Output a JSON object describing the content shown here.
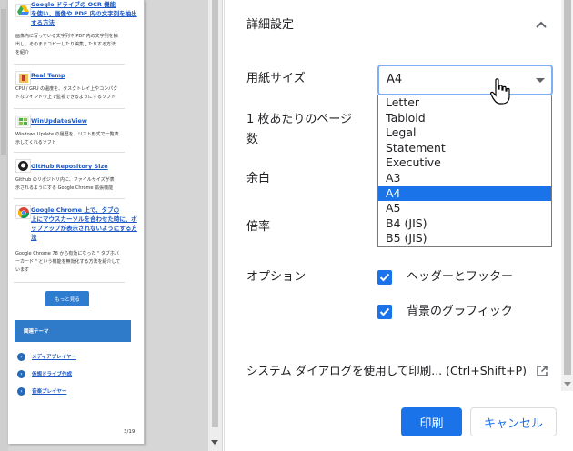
{
  "preview": {
    "items": [
      {
        "link": "Google ドライブの OCR 機能\nを使い、画像や PDF 内の文字列を抽出\nする方法",
        "desc": "画像内に写っている文字列や PDF 内の文字列を抽\n出し、そのままコピーしたり編集したりする方法\nを紹介",
        "icon": "google-drive-icon"
      },
      {
        "link": "Real Temp",
        "desc": "CPU / GPU の温度を、タスクトレイ上やコンパク\nトなウインドウ上で監視できるようにするソフト",
        "icon": "thermometer-icon"
      },
      {
        "link": "WinUpdatesView",
        "desc": "Windows Update の履歴を、リスト形式で一覧表\n示してくれるソフト",
        "icon": "windows-icon"
      },
      {
        "link": "GitHub Repository Size",
        "desc": "GitHub のリポジトリ内に、ファイルサイズが表\n示されるようにする Google Chrome 拡張機能",
        "icon": "github-icon"
      },
      {
        "link": "Google Chrome 上で、タブの\n上にマウスカーソルを合わせた時に、ポ\nップアップが表示されないようにする方\n法",
        "desc": "Google Chrome 78 から有効になった \" タブホバ\nーカード \" という機能を無効化する方法を紹介して\nいます",
        "icon": "chrome-icon"
      }
    ],
    "more_button": "もっと見る",
    "theme_header": "関連テーマ",
    "theme_links": [
      "メディアプレイヤー",
      "仮想ドライブ作成",
      "音楽プレイヤー"
    ],
    "page_number": "3/19"
  },
  "settings": {
    "advanced_header": "詳細設定",
    "paper_size_label": "用紙サイズ",
    "paper_size_value": "A4",
    "pages_per_sheet_label_line1": "1 枚あたりのページ",
    "pages_per_sheet_label_line2": "数",
    "margins_label": "余白",
    "scale_label": "倍率",
    "options_label": "オプション",
    "option_headers_footers": "ヘッダーとフッター",
    "option_background_graphics": "背景のグラフィック",
    "system_dialog_link": "システム ダイアログを使用して印刷... (Ctrl+Shift+P)",
    "print_button": "印刷",
    "cancel_button": "キャンセル"
  },
  "dropdown": {
    "options": [
      "Letter",
      "Tabloid",
      "Legal",
      "Statement",
      "Executive",
      "A3",
      "A4",
      "A5",
      "B4 (JIS)",
      "B5 (JIS)"
    ],
    "selected": "A4"
  },
  "colors": {
    "accent": "#1a73e8",
    "link": "#1a56c4"
  }
}
